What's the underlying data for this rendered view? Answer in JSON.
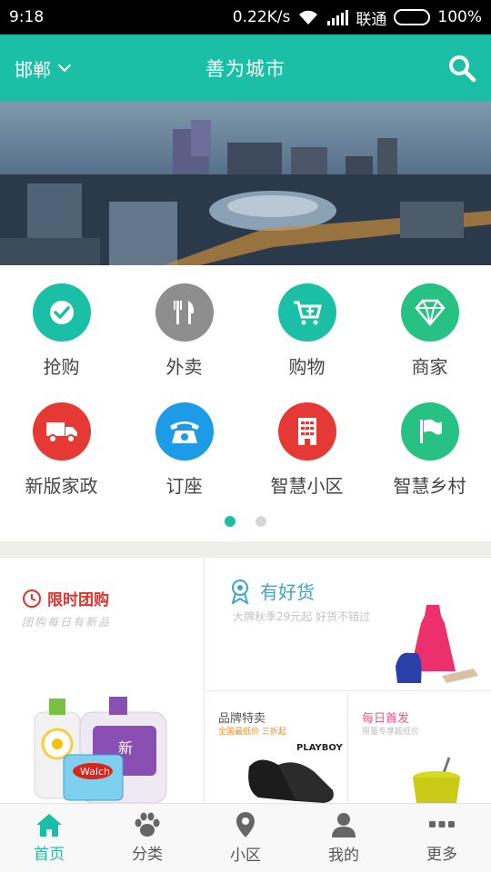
{
  "status_bar": {
    "time": "9:18",
    "net_speed": "0.22K/s",
    "carrier": "联通",
    "battery": "100%"
  },
  "header": {
    "city": "邯郸",
    "title": "善为城市"
  },
  "categories": [
    {
      "label": "抢购",
      "icon": "check-icon",
      "color": "#1bbfa6"
    },
    {
      "label": "外卖",
      "icon": "fork-knife-icon",
      "color": "#8e8e8e"
    },
    {
      "label": "购物",
      "icon": "cart-icon",
      "color": "#1bbfa6"
    },
    {
      "label": "商家",
      "icon": "diamond-icon",
      "color": "#26c183"
    },
    {
      "label": "新版家政",
      "icon": "truck-icon",
      "color": "#e53935"
    },
    {
      "label": "订座",
      "icon": "phone-icon",
      "color": "#1e9be6"
    },
    {
      "label": "智慧小区",
      "icon": "building-icon",
      "color": "#e53935"
    },
    {
      "label": "智慧乡村",
      "icon": "flag-icon",
      "color": "#26c183"
    }
  ],
  "pager": {
    "pages": 2,
    "current": 1
  },
  "promos": {
    "flash": {
      "title": "限时团购",
      "subtitle": "团购每日有新品",
      "product_text": "Walch",
      "product_text2": "新"
    },
    "goods": {
      "title": "有好货",
      "subtitle": "大牌秋季29元起 好货不错过"
    },
    "brand": {
      "title": "品牌特卖",
      "subtitle": "全国最低价 三折起",
      "logo": "PLAYBOY"
    },
    "daily": {
      "title": "每日首发",
      "subtitle": "限量专享超低价"
    }
  },
  "tabs": [
    {
      "label": "首页",
      "icon": "home-icon",
      "active": true
    },
    {
      "label": "分类",
      "icon": "paw-icon",
      "active": false
    },
    {
      "label": "小区",
      "icon": "location-pin-icon",
      "active": false
    },
    {
      "label": "我的",
      "icon": "user-icon",
      "active": false
    },
    {
      "label": "更多",
      "icon": "more-icon",
      "active": false
    }
  ],
  "colors": {
    "accent": "#1bbfa6",
    "flash_red": "#e0342f",
    "goods_teal": "#3aa6c8",
    "brand_orange": "#f08a24",
    "daily_pink": "#e8588a"
  }
}
